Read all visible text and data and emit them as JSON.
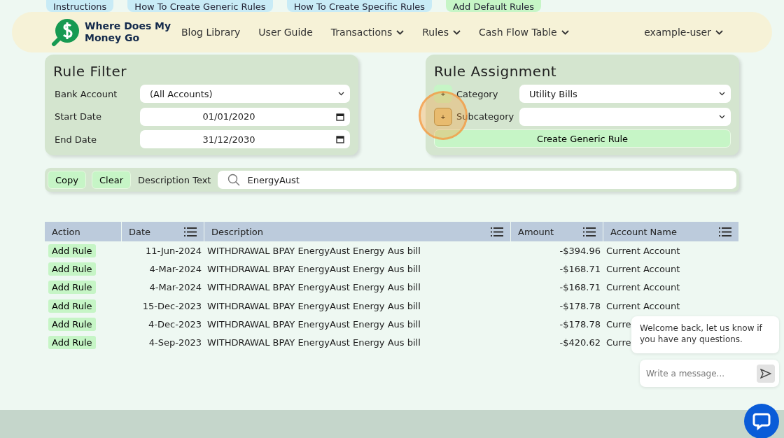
{
  "top_tabs": [
    {
      "label": "Instructions",
      "kind": "info"
    },
    {
      "label": "How To Create Generic Rules",
      "kind": "info"
    },
    {
      "label": "How To Create Specific Rules",
      "kind": "info"
    },
    {
      "label": "Add Default Rules",
      "kind": "action"
    }
  ],
  "nav": {
    "brand": "Where Does My Money Go",
    "links": [
      {
        "label": "Blog Library",
        "dropdown": false
      },
      {
        "label": "User Guide",
        "dropdown": false
      },
      {
        "label": "Transactions",
        "dropdown": true
      },
      {
        "label": "Rules",
        "dropdown": true
      },
      {
        "label": "Cash Flow Table",
        "dropdown": true
      }
    ],
    "user": "example-user"
  },
  "rule_filter": {
    "title": "Rule Filter",
    "fields": [
      {
        "label": "Bank Account",
        "value": "(All Accounts)",
        "kind": "select"
      },
      {
        "label": "Start Date",
        "value": "01/01/2020",
        "kind": "date"
      },
      {
        "label": "End Date",
        "value": "31/12/2030",
        "kind": "date"
      }
    ]
  },
  "rule_assignment": {
    "title": "Rule Assignment",
    "fields": [
      {
        "add": "+",
        "label": "Category",
        "value": "Utility Bills",
        "highlighted": false
      },
      {
        "add": "+",
        "label": "Subcategory",
        "highlighted": true
      }
    ],
    "button": "Create Generic Rule"
  },
  "search_bar": {
    "buttons": [
      "Copy",
      "Clear"
    ],
    "label": "Description Text",
    "value": "EnergyAust"
  },
  "table": {
    "columns": [
      {
        "label": "Action",
        "menu": false
      },
      {
        "label": "Date",
        "menu": true
      },
      {
        "label": "Description",
        "menu": true
      },
      {
        "label": "Amount",
        "menu": true
      },
      {
        "label": "Account Name",
        "menu": true
      }
    ],
    "rows": [
      {
        "action": "Add Rule",
        "date": "11-Jun-2024",
        "description": "WITHDRAWAL BPAY EnergyAust Energy Aus bill",
        "amount": "-$394.96",
        "account": "Current Account"
      },
      {
        "action": "Add Rule",
        "date": "4-Mar-2024",
        "description": "WITHDRAWAL BPAY EnergyAust Energy Aus bill",
        "amount": "-$168.71",
        "account": "Current Account"
      },
      {
        "action": "Add Rule",
        "date": "4-Mar-2024",
        "description": "WITHDRAWAL BPAY EnergyAust Energy Aus bill",
        "amount": "-$168.71",
        "account": "Current Account"
      },
      {
        "action": "Add Rule",
        "date": "15-Dec-2023",
        "description": "WITHDRAWAL BPAY EnergyAust Energy Aus bill",
        "amount": "-$178.78",
        "account": "Current Account"
      },
      {
        "action": "Add Rule",
        "date": "4-Dec-2023",
        "description": "WITHDRAWAL BPAY EnergyAust Energy Aus bill",
        "amount": "-$178.78",
        "account": "Curre"
      },
      {
        "action": "Add Rule",
        "date": "4-Sep-2023",
        "description": "WITHDRAWAL BPAY EnergyAust Energy Aus bill",
        "amount": "-$420.62",
        "account": "Curre"
      }
    ]
  },
  "chat": {
    "message": "Welcome back, let us know if you have any questions.",
    "placeholder": "Write a message..."
  }
}
